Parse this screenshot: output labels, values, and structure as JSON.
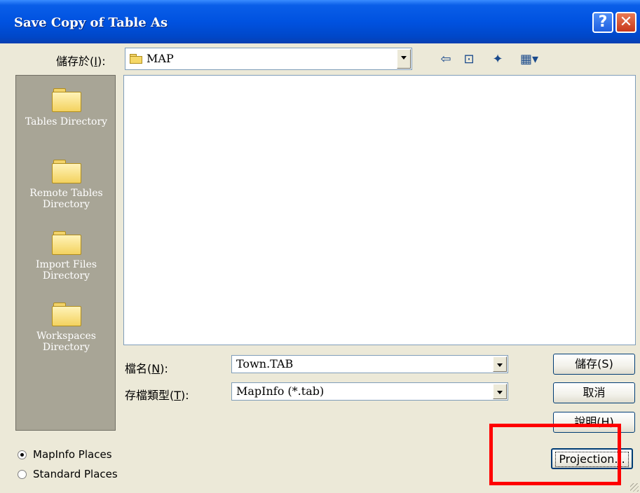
{
  "window": {
    "title": "Save Copy of Table As",
    "help_glyph": "?",
    "close_glyph": "✕"
  },
  "save_in": {
    "label_pre": "儲存於(",
    "label_key": "I",
    "label_post": "):",
    "value": "MAP"
  },
  "toolbar": {
    "back": "⇦",
    "up": "⊡",
    "new_folder": "✦",
    "view_menu": "▦▾"
  },
  "places": [
    {
      "label": "Tables Directory"
    },
    {
      "label": "Remote Tables Directory"
    },
    {
      "label": "Import Files Directory"
    },
    {
      "label": "Workspaces Directory"
    }
  ],
  "filename": {
    "label_pre": "檔名(",
    "label_key": "N",
    "label_post": "):",
    "value": "Town.TAB"
  },
  "filetype": {
    "label_pre": "存檔類型(",
    "label_key": "T",
    "label_post": "):",
    "value": "MapInfo (*.tab)"
  },
  "buttons": {
    "save": "儲存(S)",
    "cancel": "取消",
    "help": "說明(H)",
    "projection": "Projection..."
  },
  "radios": {
    "mapinfo_places": {
      "label": "MapInfo Places",
      "selected": true
    },
    "standard_places": {
      "label": "Standard Places",
      "selected": false
    }
  },
  "colors": {
    "titlebar": "#0052e0",
    "places_bar": "#a8a596",
    "annotation": "#ff0000"
  }
}
